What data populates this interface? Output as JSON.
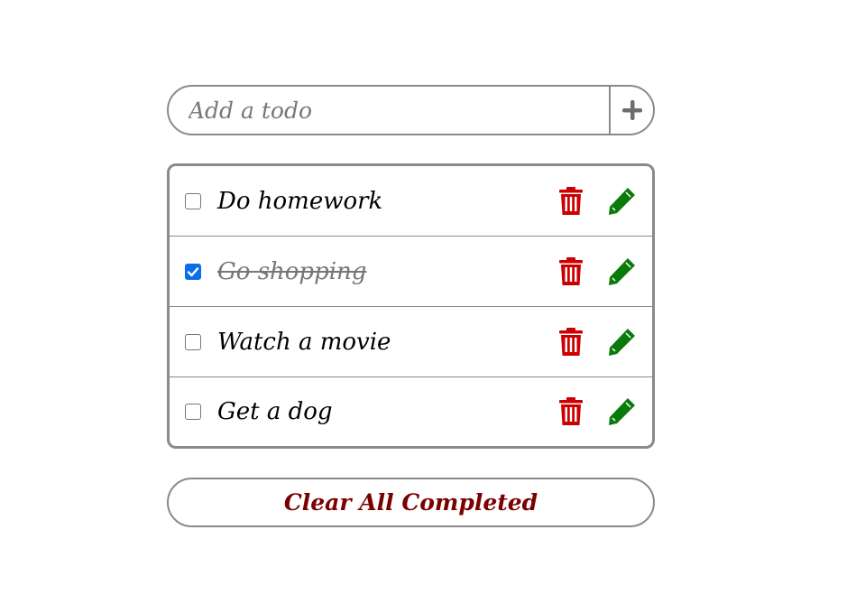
{
  "add": {
    "placeholder": "Add a todo",
    "value": "",
    "button_icon": "plus-icon"
  },
  "todos": [
    {
      "text": "Do homework",
      "completed": false
    },
    {
      "text": "Go shopping",
      "completed": true
    },
    {
      "text": "Watch a movie",
      "completed": false
    },
    {
      "text": "Get a dog",
      "completed": false
    }
  ],
  "actions": {
    "delete_icon": "trash-icon",
    "edit_icon": "pencil-icon"
  },
  "clear_button": {
    "label": "Clear All Completed"
  },
  "colors": {
    "delete": "#cc0000",
    "edit": "#0a7a0a",
    "clear_text": "#7a0000",
    "checkbox_checked": "#0b6ee6",
    "border": "#8a8a8a"
  }
}
